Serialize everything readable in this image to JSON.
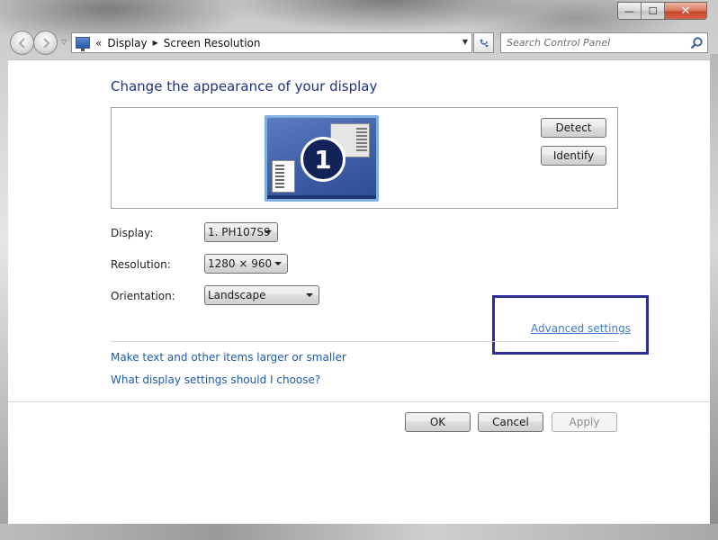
{
  "window": {
    "caption_minimize": "—",
    "caption_maximize": "☐",
    "caption_close": "✕"
  },
  "nav": {
    "back_icon": "back-arrow-icon",
    "forward_icon": "forward-arrow-icon",
    "overflow_symbol": "«",
    "breadcrumb": [
      "Display",
      "Screen Resolution"
    ],
    "search_placeholder": "Search Control Panel"
  },
  "page": {
    "title": "Change the appearance of your display",
    "monitor_number": "1",
    "detect_button": "Detect",
    "identify_button": "Identify"
  },
  "settings": {
    "display_label": "Display:",
    "display_value": "1. PH107S9",
    "resolution_label": "Resolution:",
    "resolution_value": "1280 × 960",
    "orientation_label": "Orientation:",
    "orientation_value": "Landscape"
  },
  "links": {
    "advanced": "Advanced settings",
    "text_size": "Make text and other items larger or smaller",
    "help": "What display settings should I choose?"
  },
  "footer": {
    "ok": "OK",
    "cancel": "Cancel",
    "apply": "Apply"
  },
  "colors": {
    "title_blue": "#1e3287",
    "link_blue": "#1e5aa8",
    "highlight_box": "#2c2c9a"
  }
}
